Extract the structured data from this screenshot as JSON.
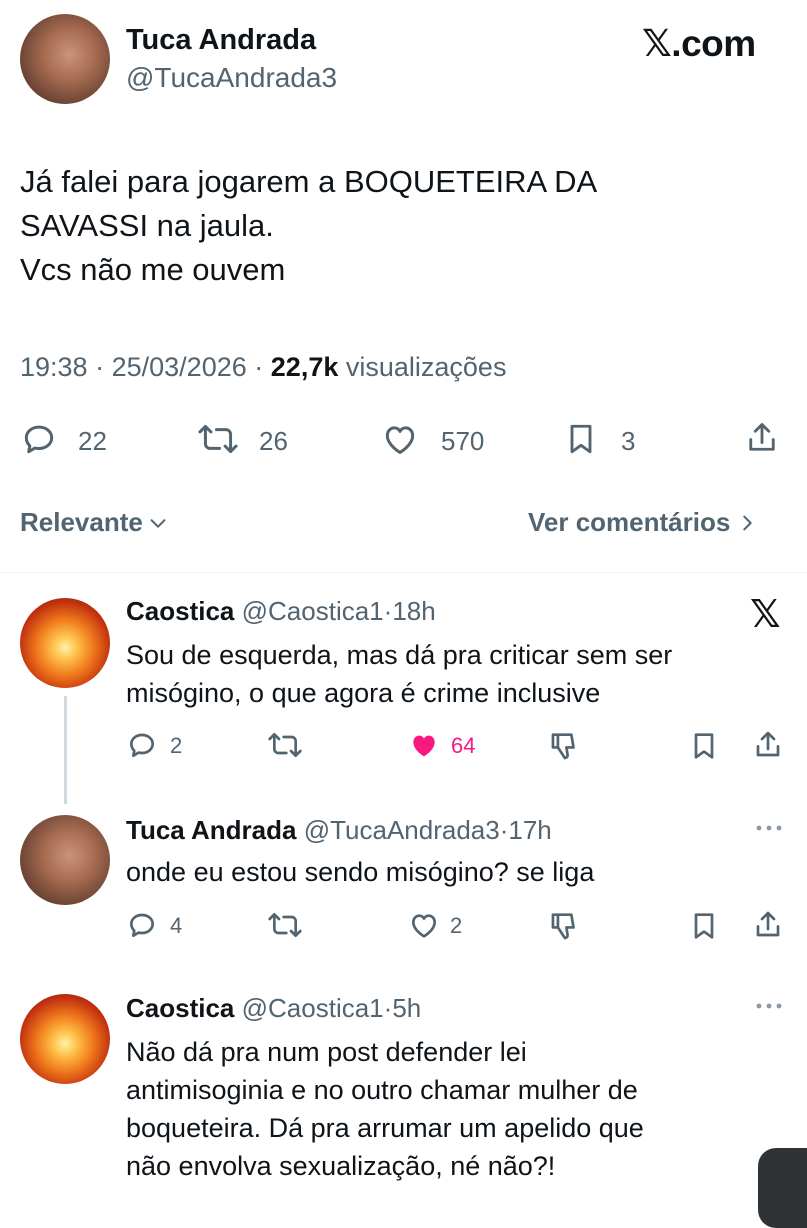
{
  "tweet": {
    "author_name": "Tuca Andrada",
    "author_handle": "@TucaAndrada3",
    "brand": "𝕏.com",
    "text_lines": [
      "Já falei para jogarem a BOQUETEIRA DA",
      "SAVASSI na jaula.",
      "Vcs não me ouvem"
    ],
    "time": "19:38",
    "date": "25/03/2026",
    "views_count": "22,7k",
    "views_label": "visualizações",
    "replies": "22",
    "retweets": "26",
    "likes": "570",
    "bookmarks": "3"
  },
  "sort": {
    "label": "Relevante",
    "see_comments": "Ver comentários"
  },
  "replies": [
    {
      "name": "Caostica",
      "handle": "@Caostica1",
      "age": "18h",
      "text_lines": [
        "Sou de esquerda, mas dá pra criticar sem ser",
        "misógino, o que agora é crime inclusive"
      ],
      "replies": "2",
      "retweets": "",
      "likes": "64"
    },
    {
      "name": "Tuca Andrada",
      "handle": "@TucaAndrada3",
      "age": "17h",
      "text_lines": [
        "onde eu estou sendo misógino? se liga"
      ],
      "replies": "4",
      "retweets": "",
      "likes": "2"
    },
    {
      "name": "Caostica",
      "handle": "@Caostica1",
      "age": "5h",
      "text_lines": [
        "Não dá pra num post defender lei",
        "antimisoginia e no outro chamar mulher de",
        "boqueteira. Dá pra arrumar um apelido que",
        "não envolva sexualização, né não?!"
      ]
    }
  ],
  "separator": "·",
  "colors": {
    "text": "#0f1419",
    "muted": "#536471",
    "like_active": "#f91880",
    "divider": "#eff3f4"
  },
  "icons": [
    "reply-icon",
    "retweet-icon",
    "like-icon",
    "bookmark-icon",
    "share-icon",
    "x-logo-icon",
    "more-icon",
    "chevron-down-icon",
    "chevron-right-icon",
    "downvote-icon"
  ]
}
